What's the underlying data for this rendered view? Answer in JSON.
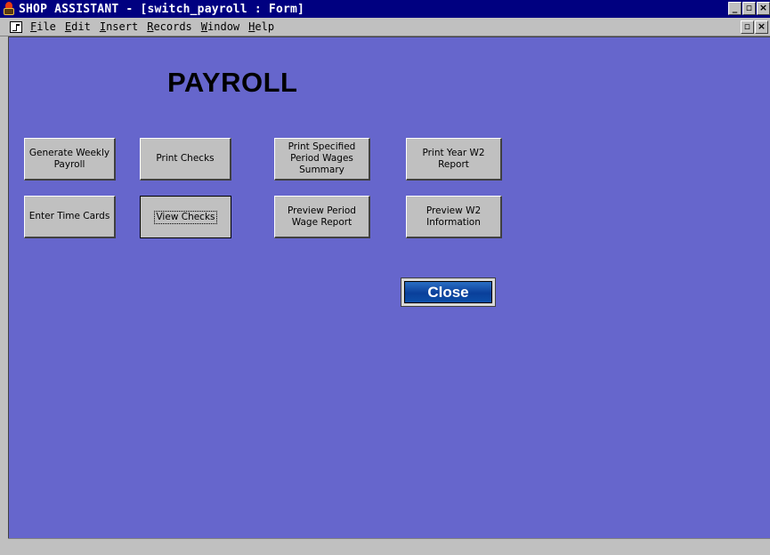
{
  "window": {
    "title": "SHOP ASSISTANT - [switch_payroll : Form]",
    "controls": {
      "minimize": "_",
      "maximize": "▫",
      "close": "×"
    }
  },
  "menubar": {
    "items": [
      {
        "label": "File",
        "accel": "F"
      },
      {
        "label": "Edit",
        "accel": "E"
      },
      {
        "label": "Insert",
        "accel": "I"
      },
      {
        "label": "Records",
        "accel": "R"
      },
      {
        "label": "Window",
        "accel": "W"
      },
      {
        "label": "Help",
        "accel": "H"
      }
    ],
    "restore": "▫",
    "close": "×"
  },
  "form": {
    "title": "PAYROLL",
    "background_color": "#6666cc",
    "buttons": {
      "generate_weekly_payroll": "Generate Weekly Payroll",
      "print_checks": "Print Checks",
      "print_period_wages_summary": "Print Specified Period Wages Summary",
      "print_year_w2_report": "Print Year W2 Report",
      "enter_time_cards": "Enter Time Cards",
      "view_checks": "View Checks",
      "preview_period_wage_report": "Preview Period Wage Report",
      "preview_w2_information": "Preview W2 Information"
    },
    "focused_button": "view_checks",
    "close_label": "Close"
  },
  "icons": {
    "app": "shop-assistant-icon",
    "form": "form-icon"
  }
}
